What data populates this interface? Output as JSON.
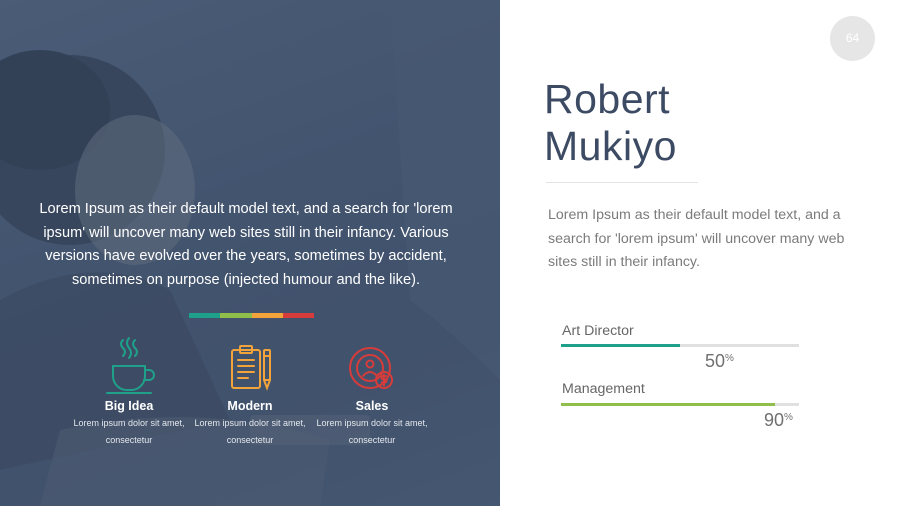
{
  "page_number": "64",
  "intro_text": "Lorem Ipsum as their default model text, and a search for 'lorem ipsum' will uncover many web sites still in their infancy. Various versions have evolved over the years, sometimes by accident, sometimes on purpose (injected humour and the like).",
  "color_bar": [
    "#1fa08a",
    "#8fbf4a",
    "#f2a43a",
    "#d63c3a"
  ],
  "features": [
    {
      "title": "Big Idea",
      "desc": "Lorem ipsum dolor sit amet, consectetur",
      "icon": "coffee-cup-icon",
      "color": "#1fa08a"
    },
    {
      "title": "Modern",
      "desc": "Lorem ipsum dolor sit amet, consectetur",
      "icon": "clipboard-pen-icon",
      "color": "#f2a43a"
    },
    {
      "title": "Sales",
      "desc": "Lorem ipsum dolor sit amet, consectetur",
      "icon": "sales-target-icon",
      "color": "#d63c3a"
    }
  ],
  "profile": {
    "first_name": "Robert",
    "last_name": "Mukiyo",
    "bio": "Lorem Ipsum as their default model text, and a search for 'lorem ipsum' will uncover many web sites still in their infancy."
  },
  "skills": [
    {
      "label": "Art Director",
      "value": 50,
      "value_text": "50",
      "unit": "%",
      "color": "#1fa08a"
    },
    {
      "label": "Management",
      "value": 90,
      "value_text": "90",
      "unit": "%",
      "color": "#8fbf4a"
    }
  ]
}
